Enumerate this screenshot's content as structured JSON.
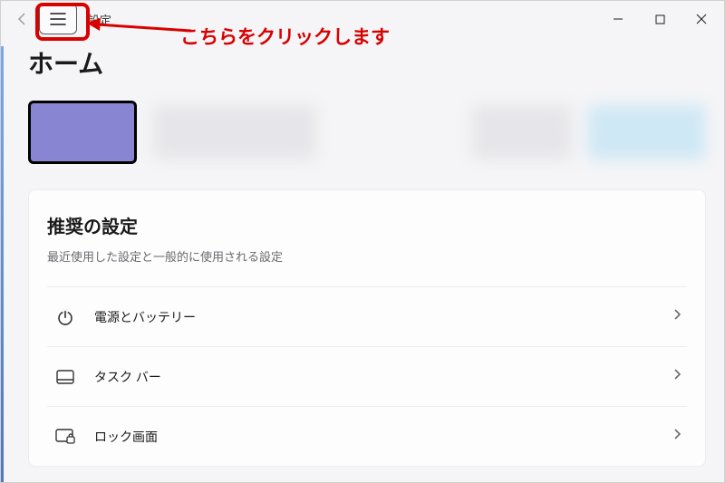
{
  "titlebar": {
    "back_label": "←",
    "text": "設定"
  },
  "page": {
    "title": "ホーム"
  },
  "annotation": {
    "text": "こちらをクリックします"
  },
  "recommended": {
    "title": "推奨の設定",
    "subtitle": "最近使用した設定と一般的に使用される設定",
    "items": [
      {
        "icon": "power-icon",
        "label": "電源とバッテリー"
      },
      {
        "icon": "taskbar-icon",
        "label": "タスク バー"
      },
      {
        "icon": "lock-screen-icon",
        "label": "ロック画面"
      }
    ]
  }
}
